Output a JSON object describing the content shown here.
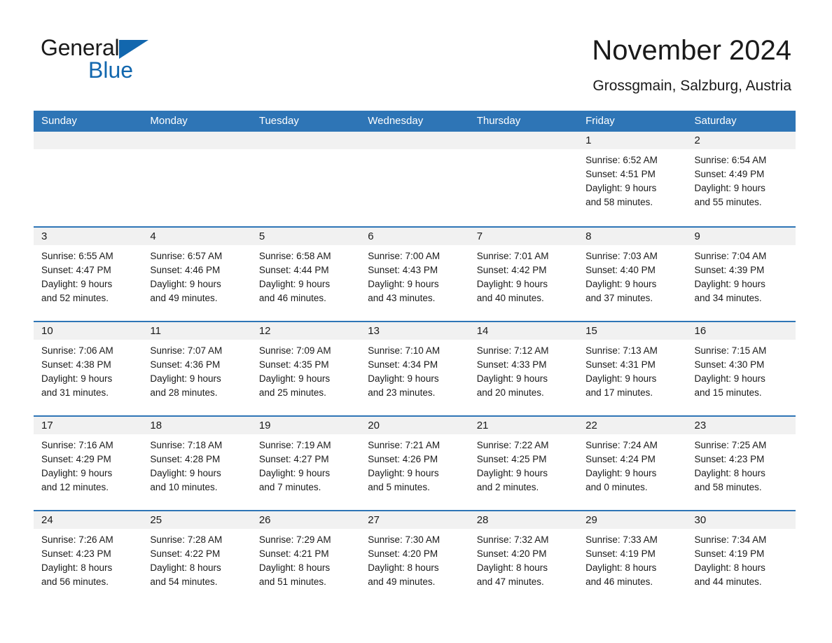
{
  "brand": {
    "line1": "General",
    "line2": "Blue",
    "triangle_color": "#1267AE"
  },
  "header": {
    "month_title": "November 2024",
    "location": "Grossgmain, Salzburg, Austria"
  },
  "theme": {
    "header_blue": "#2E75B6",
    "daynum_band": "#F1F1F1",
    "text": "#1a1a1a"
  },
  "weekdays": [
    "Sunday",
    "Monday",
    "Tuesday",
    "Wednesday",
    "Thursday",
    "Friday",
    "Saturday"
  ],
  "weeks": [
    [
      {
        "day": "",
        "sunrise": "",
        "sunset": "",
        "daylight1": "",
        "daylight2": ""
      },
      {
        "day": "",
        "sunrise": "",
        "sunset": "",
        "daylight1": "",
        "daylight2": ""
      },
      {
        "day": "",
        "sunrise": "",
        "sunset": "",
        "daylight1": "",
        "daylight2": ""
      },
      {
        "day": "",
        "sunrise": "",
        "sunset": "",
        "daylight1": "",
        "daylight2": ""
      },
      {
        "day": "",
        "sunrise": "",
        "sunset": "",
        "daylight1": "",
        "daylight2": ""
      },
      {
        "day": "1",
        "sunrise": "Sunrise: 6:52 AM",
        "sunset": "Sunset: 4:51 PM",
        "daylight1": "Daylight: 9 hours",
        "daylight2": "and 58 minutes."
      },
      {
        "day": "2",
        "sunrise": "Sunrise: 6:54 AM",
        "sunset": "Sunset: 4:49 PM",
        "daylight1": "Daylight: 9 hours",
        "daylight2": "and 55 minutes."
      }
    ],
    [
      {
        "day": "3",
        "sunrise": "Sunrise: 6:55 AM",
        "sunset": "Sunset: 4:47 PM",
        "daylight1": "Daylight: 9 hours",
        "daylight2": "and 52 minutes."
      },
      {
        "day": "4",
        "sunrise": "Sunrise: 6:57 AM",
        "sunset": "Sunset: 4:46 PM",
        "daylight1": "Daylight: 9 hours",
        "daylight2": "and 49 minutes."
      },
      {
        "day": "5",
        "sunrise": "Sunrise: 6:58 AM",
        "sunset": "Sunset: 4:44 PM",
        "daylight1": "Daylight: 9 hours",
        "daylight2": "and 46 minutes."
      },
      {
        "day": "6",
        "sunrise": "Sunrise: 7:00 AM",
        "sunset": "Sunset: 4:43 PM",
        "daylight1": "Daylight: 9 hours",
        "daylight2": "and 43 minutes."
      },
      {
        "day": "7",
        "sunrise": "Sunrise: 7:01 AM",
        "sunset": "Sunset: 4:42 PM",
        "daylight1": "Daylight: 9 hours",
        "daylight2": "and 40 minutes."
      },
      {
        "day": "8",
        "sunrise": "Sunrise: 7:03 AM",
        "sunset": "Sunset: 4:40 PM",
        "daylight1": "Daylight: 9 hours",
        "daylight2": "and 37 minutes."
      },
      {
        "day": "9",
        "sunrise": "Sunrise: 7:04 AM",
        "sunset": "Sunset: 4:39 PM",
        "daylight1": "Daylight: 9 hours",
        "daylight2": "and 34 minutes."
      }
    ],
    [
      {
        "day": "10",
        "sunrise": "Sunrise: 7:06 AM",
        "sunset": "Sunset: 4:38 PM",
        "daylight1": "Daylight: 9 hours",
        "daylight2": "and 31 minutes."
      },
      {
        "day": "11",
        "sunrise": "Sunrise: 7:07 AM",
        "sunset": "Sunset: 4:36 PM",
        "daylight1": "Daylight: 9 hours",
        "daylight2": "and 28 minutes."
      },
      {
        "day": "12",
        "sunrise": "Sunrise: 7:09 AM",
        "sunset": "Sunset: 4:35 PM",
        "daylight1": "Daylight: 9 hours",
        "daylight2": "and 25 minutes."
      },
      {
        "day": "13",
        "sunrise": "Sunrise: 7:10 AM",
        "sunset": "Sunset: 4:34 PM",
        "daylight1": "Daylight: 9 hours",
        "daylight2": "and 23 minutes."
      },
      {
        "day": "14",
        "sunrise": "Sunrise: 7:12 AM",
        "sunset": "Sunset: 4:33 PM",
        "daylight1": "Daylight: 9 hours",
        "daylight2": "and 20 minutes."
      },
      {
        "day": "15",
        "sunrise": "Sunrise: 7:13 AM",
        "sunset": "Sunset: 4:31 PM",
        "daylight1": "Daylight: 9 hours",
        "daylight2": "and 17 minutes."
      },
      {
        "day": "16",
        "sunrise": "Sunrise: 7:15 AM",
        "sunset": "Sunset: 4:30 PM",
        "daylight1": "Daylight: 9 hours",
        "daylight2": "and 15 minutes."
      }
    ],
    [
      {
        "day": "17",
        "sunrise": "Sunrise: 7:16 AM",
        "sunset": "Sunset: 4:29 PM",
        "daylight1": "Daylight: 9 hours",
        "daylight2": "and 12 minutes."
      },
      {
        "day": "18",
        "sunrise": "Sunrise: 7:18 AM",
        "sunset": "Sunset: 4:28 PM",
        "daylight1": "Daylight: 9 hours",
        "daylight2": "and 10 minutes."
      },
      {
        "day": "19",
        "sunrise": "Sunrise: 7:19 AM",
        "sunset": "Sunset: 4:27 PM",
        "daylight1": "Daylight: 9 hours",
        "daylight2": "and 7 minutes."
      },
      {
        "day": "20",
        "sunrise": "Sunrise: 7:21 AM",
        "sunset": "Sunset: 4:26 PM",
        "daylight1": "Daylight: 9 hours",
        "daylight2": "and 5 minutes."
      },
      {
        "day": "21",
        "sunrise": "Sunrise: 7:22 AM",
        "sunset": "Sunset: 4:25 PM",
        "daylight1": "Daylight: 9 hours",
        "daylight2": "and 2 minutes."
      },
      {
        "day": "22",
        "sunrise": "Sunrise: 7:24 AM",
        "sunset": "Sunset: 4:24 PM",
        "daylight1": "Daylight: 9 hours",
        "daylight2": "and 0 minutes."
      },
      {
        "day": "23",
        "sunrise": "Sunrise: 7:25 AM",
        "sunset": "Sunset: 4:23 PM",
        "daylight1": "Daylight: 8 hours",
        "daylight2": "and 58 minutes."
      }
    ],
    [
      {
        "day": "24",
        "sunrise": "Sunrise: 7:26 AM",
        "sunset": "Sunset: 4:23 PM",
        "daylight1": "Daylight: 8 hours",
        "daylight2": "and 56 minutes."
      },
      {
        "day": "25",
        "sunrise": "Sunrise: 7:28 AM",
        "sunset": "Sunset: 4:22 PM",
        "daylight1": "Daylight: 8 hours",
        "daylight2": "and 54 minutes."
      },
      {
        "day": "26",
        "sunrise": "Sunrise: 7:29 AM",
        "sunset": "Sunset: 4:21 PM",
        "daylight1": "Daylight: 8 hours",
        "daylight2": "and 51 minutes."
      },
      {
        "day": "27",
        "sunrise": "Sunrise: 7:30 AM",
        "sunset": "Sunset: 4:20 PM",
        "daylight1": "Daylight: 8 hours",
        "daylight2": "and 49 minutes."
      },
      {
        "day": "28",
        "sunrise": "Sunrise: 7:32 AM",
        "sunset": "Sunset: 4:20 PM",
        "daylight1": "Daylight: 8 hours",
        "daylight2": "and 47 minutes."
      },
      {
        "day": "29",
        "sunrise": "Sunrise: 7:33 AM",
        "sunset": "Sunset: 4:19 PM",
        "daylight1": "Daylight: 8 hours",
        "daylight2": "and 46 minutes."
      },
      {
        "day": "30",
        "sunrise": "Sunrise: 7:34 AM",
        "sunset": "Sunset: 4:19 PM",
        "daylight1": "Daylight: 8 hours",
        "daylight2": "and 44 minutes."
      }
    ]
  ]
}
